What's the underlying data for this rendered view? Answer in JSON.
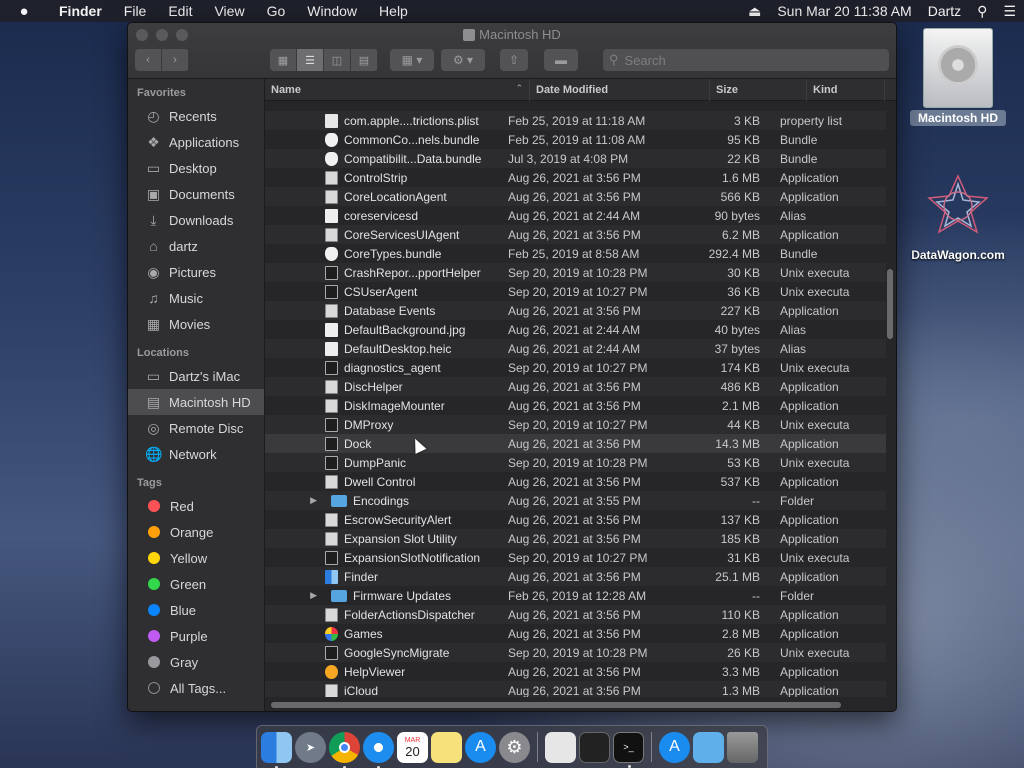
{
  "menubar": {
    "apple": "",
    "app_name": "Finder",
    "items": [
      "File",
      "Edit",
      "View",
      "Go",
      "Window",
      "Help"
    ],
    "datetime": "Sun Mar 20  11:38 AM",
    "user": "Dartz"
  },
  "desktop": {
    "hd_label": "Macintosh HD",
    "datawagon_label": "DataWagon.com"
  },
  "window": {
    "title": "Macintosh HD",
    "search_placeholder": "Search"
  },
  "sidebar": {
    "favorites_header": "Favorites",
    "favorites": [
      {
        "label": "Recents",
        "icon": "clock-icon"
      },
      {
        "label": "Applications",
        "icon": "applications-icon"
      },
      {
        "label": "Desktop",
        "icon": "desktop-icon"
      },
      {
        "label": "Documents",
        "icon": "documents-icon"
      },
      {
        "label": "Downloads",
        "icon": "downloads-icon"
      },
      {
        "label": "dartz",
        "icon": "home-icon"
      },
      {
        "label": "Pictures",
        "icon": "pictures-icon"
      },
      {
        "label": "Music",
        "icon": "music-icon"
      },
      {
        "label": "Movies",
        "icon": "movies-icon"
      }
    ],
    "locations_header": "Locations",
    "locations": [
      {
        "label": "Dartz's iMac",
        "icon": "imac-icon"
      },
      {
        "label": "Macintosh HD",
        "icon": "harddisk-icon"
      },
      {
        "label": "Remote Disc",
        "icon": "disc-icon"
      },
      {
        "label": "Network",
        "icon": "network-icon"
      }
    ],
    "tags_header": "Tags",
    "tags": [
      {
        "label": "Red",
        "color": "#ff5257"
      },
      {
        "label": "Orange",
        "color": "#ff9f0a"
      },
      {
        "label": "Yellow",
        "color": "#ffd60a"
      },
      {
        "label": "Green",
        "color": "#32d74b"
      },
      {
        "label": "Blue",
        "color": "#0a84ff"
      },
      {
        "label": "Purple",
        "color": "#bf5af2"
      },
      {
        "label": "Gray",
        "color": "#98989d"
      }
    ],
    "all_tags": "All Tags..."
  },
  "columns": {
    "name": "Name",
    "date": "Date Modified",
    "size": "Size",
    "kind": "Kind"
  },
  "files": [
    {
      "name": "com.apple....trictions.plist",
      "date": "Feb 25, 2019 at 11:18 AM",
      "size": "3 KB",
      "kind": "property list",
      "icon": "doc"
    },
    {
      "name": "CommonCo...nels.bundle",
      "date": "Feb 25, 2019 at 11:08 AM",
      "size": "95 KB",
      "kind": "Bundle",
      "icon": "bundle"
    },
    {
      "name": "Compatibilit...Data.bundle",
      "date": "Jul 3, 2019 at 4:08 PM",
      "size": "22 KB",
      "kind": "Bundle",
      "icon": "bundle"
    },
    {
      "name": "ControlStrip",
      "date": "Aug 26, 2021 at 3:56 PM",
      "size": "1.6 MB",
      "kind": "Application",
      "icon": "app"
    },
    {
      "name": "CoreLocationAgent",
      "date": "Aug 26, 2021 at 3:56 PM",
      "size": "566 KB",
      "kind": "Application",
      "icon": "app"
    },
    {
      "name": "coreservicesd",
      "date": "Aug 26, 2021 at 2:44 AM",
      "size": "90 bytes",
      "kind": "Alias",
      "icon": "alias"
    },
    {
      "name": "CoreServicesUIAgent",
      "date": "Aug 26, 2021 at 3:56 PM",
      "size": "6.2 MB",
      "kind": "Application",
      "icon": "app"
    },
    {
      "name": "CoreTypes.bundle",
      "date": "Feb 25, 2019 at 8:58 AM",
      "size": "292.4 MB",
      "kind": "Bundle",
      "icon": "bundle"
    },
    {
      "name": "CrashRepor...pportHelper",
      "date": "Sep 20, 2019 at 10:28 PM",
      "size": "30 KB",
      "kind": "Unix executable",
      "icon": "exec"
    },
    {
      "name": "CSUserAgent",
      "date": "Sep 20, 2019 at 10:27 PM",
      "size": "36 KB",
      "kind": "Unix executable",
      "icon": "exec"
    },
    {
      "name": "Database Events",
      "date": "Aug 26, 2021 at 3:56 PM",
      "size": "227 KB",
      "kind": "Application",
      "icon": "app"
    },
    {
      "name": "DefaultBackground.jpg",
      "date": "Aug 26, 2021 at 2:44 AM",
      "size": "40 bytes",
      "kind": "Alias",
      "icon": "alias"
    },
    {
      "name": "DefaultDesktop.heic",
      "date": "Aug 26, 2021 at 2:44 AM",
      "size": "37 bytes",
      "kind": "Alias",
      "icon": "alias"
    },
    {
      "name": "diagnostics_agent",
      "date": "Sep 20, 2019 at 10:27 PM",
      "size": "174 KB",
      "kind": "Unix executable",
      "icon": "exec"
    },
    {
      "name": "DiscHelper",
      "date": "Aug 26, 2021 at 3:56 PM",
      "size": "486 KB",
      "kind": "Application",
      "icon": "app"
    },
    {
      "name": "DiskImageMounter",
      "date": "Aug 26, 2021 at 3:56 PM",
      "size": "2.1 MB",
      "kind": "Application",
      "icon": "app"
    },
    {
      "name": "DMProxy",
      "date": "Sep 20, 2019 at 10:27 PM",
      "size": "44 KB",
      "kind": "Unix executable",
      "icon": "exec"
    },
    {
      "name": "Dock",
      "date": "Aug 26, 2021 at 3:56 PM",
      "size": "14.3 MB",
      "kind": "Application",
      "icon": "exec"
    },
    {
      "name": "DumpPanic",
      "date": "Sep 20, 2019 at 10:28 PM",
      "size": "53 KB",
      "kind": "Unix executable",
      "icon": "exec"
    },
    {
      "name": "Dwell Control",
      "date": "Aug 26, 2021 at 3:56 PM",
      "size": "537 KB",
      "kind": "Application",
      "icon": "app"
    },
    {
      "name": "Encodings",
      "date": "Aug 26, 2021 at 3:55 PM",
      "size": "--",
      "kind": "Folder",
      "icon": "folder",
      "arrow": "▶"
    },
    {
      "name": "EscrowSecurityAlert",
      "date": "Aug 26, 2021 at 3:56 PM",
      "size": "137 KB",
      "kind": "Application",
      "icon": "app"
    },
    {
      "name": "Expansion Slot Utility",
      "date": "Aug 26, 2021 at 3:56 PM",
      "size": "185 KB",
      "kind": "Application",
      "icon": "app"
    },
    {
      "name": "ExpansionSlotNotification",
      "date": "Sep 20, 2019 at 10:27 PM",
      "size": "31 KB",
      "kind": "Unix executable",
      "icon": "exec"
    },
    {
      "name": "Finder",
      "date": "Aug 26, 2021 at 3:56 PM",
      "size": "25.1 MB",
      "kind": "Application",
      "icon": "finder"
    },
    {
      "name": "Firmware Updates",
      "date": "Feb 26, 2019 at 12:28 AM",
      "size": "--",
      "kind": "Folder",
      "icon": "folder",
      "arrow": "▶"
    },
    {
      "name": "FolderActionsDispatcher",
      "date": "Aug 26, 2021 at 3:56 PM",
      "size": "110 KB",
      "kind": "Application",
      "icon": "app"
    },
    {
      "name": "Games",
      "date": "Aug 26, 2021 at 3:56 PM",
      "size": "2.8 MB",
      "kind": "Application",
      "icon": "games"
    },
    {
      "name": "GoogleSyncMigrate",
      "date": "Sep 20, 2019 at 10:28 PM",
      "size": "26 KB",
      "kind": "Unix executable",
      "icon": "exec"
    },
    {
      "name": "HelpViewer",
      "date": "Aug 26, 2021 at 3:56 PM",
      "size": "3.3 MB",
      "kind": "Application",
      "icon": "help"
    },
    {
      "name": "iCloud",
      "date": "Aug 26, 2021 at 3:56 PM",
      "size": "1.3 MB",
      "kind": "Application",
      "icon": "app"
    }
  ],
  "dock": {
    "calendar_day": "20",
    "calendar_month": "MAR"
  }
}
